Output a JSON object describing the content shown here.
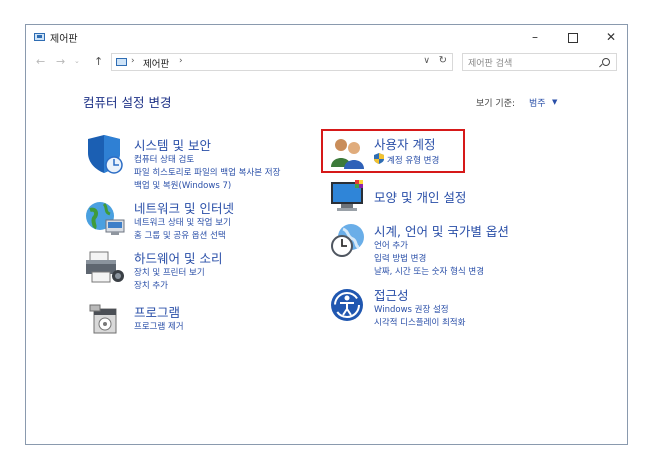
{
  "window": {
    "title": "제어판",
    "minimize_label": "–",
    "close_label": "✕"
  },
  "nav": {
    "back": "←",
    "forward": "→",
    "recent": "⌄",
    "up": "↑"
  },
  "address": {
    "crumb": "제어판",
    "sep1": "›",
    "sep2": "›",
    "dropdown": "∨",
    "refresh": "↻"
  },
  "search": {
    "placeholder": "제어판 검색"
  },
  "page": {
    "heading": "컴퓨터 설정 변경",
    "view_by_label": "보기 기준:",
    "view_by_value": "범주",
    "view_by_arrow": "▼"
  },
  "categories": {
    "system": {
      "title": "시스템 및 보안",
      "links": [
        "컴퓨터 상태 검토",
        "파일 히스토리로 파일의 백업 복사본 저장",
        "백업 및 복원(Windows 7)"
      ]
    },
    "network": {
      "title": "네트워크 및 인터넷",
      "links": [
        "네트워크 상태 및 작업 보기",
        "홈 그룹 및 공유 옵션 선택"
      ]
    },
    "hardware": {
      "title": "하드웨어 및 소리",
      "links": [
        "장치 및 프린터 보기",
        "장치 추가"
      ]
    },
    "programs": {
      "title": "프로그램",
      "links": [
        "프로그램 제거"
      ]
    },
    "users": {
      "title": "사용자 계정",
      "links": [
        "계정 유형 변경"
      ]
    },
    "appearance": {
      "title": "모양 및 개인 설정",
      "links": []
    },
    "clock": {
      "title": "시계, 언어 및 국가별 옵션",
      "links": [
        "언어 추가",
        "입력 방법 변경",
        "날짜, 시간 또는 숫자 형식 변경"
      ]
    },
    "ease": {
      "title": "접근성",
      "links": [
        "Windows 권장 설정",
        "시각적 디스플레이 최적화"
      ]
    }
  },
  "colors": {
    "link": "#2a4fa8",
    "heading": "#1e3287",
    "highlight": "#d61919"
  }
}
